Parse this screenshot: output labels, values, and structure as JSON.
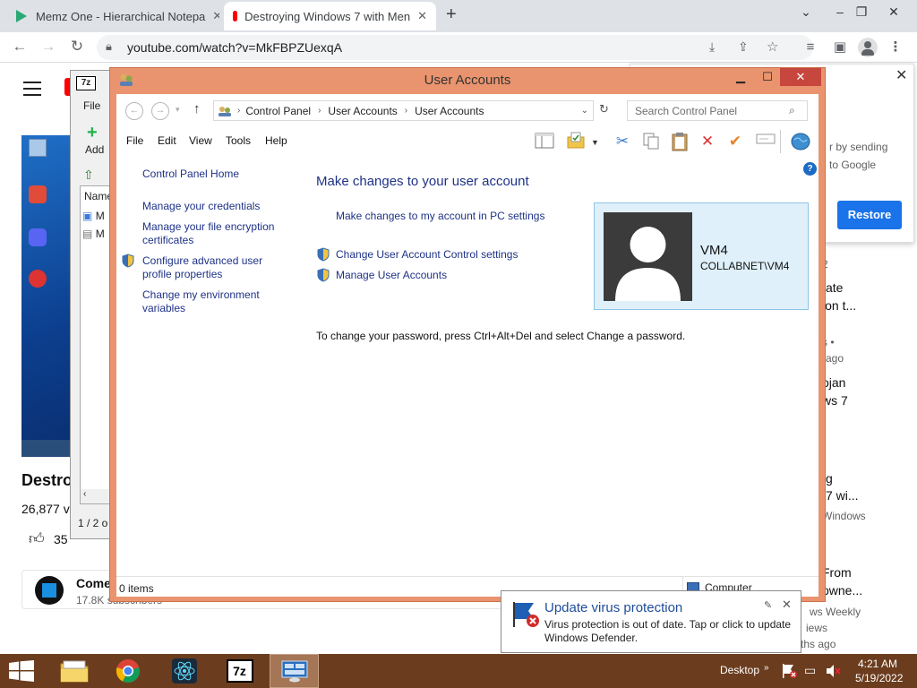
{
  "browser": {
    "tabs": [
      {
        "title": "Memz One - Hierarchical Notepa",
        "active": false
      },
      {
        "title": "Destroying Windows 7 with Men",
        "active": true
      }
    ],
    "new_tab": "+",
    "url": "youtube.com/watch?v=MkFBPZUexqA"
  },
  "youtube": {
    "video_title": "Destro",
    "views": "26,877 v",
    "likes": "35",
    "channel_name": "Come",
    "subscribers": "17.8K subscribers",
    "dialog": {
      "text_line1": "r by sending",
      "text_line2": "to Google",
      "restore_label": "Restore"
    },
    "sidebar_fragments": [
      "2",
      "ate",
      "ion t...",
      "s •",
      "ago",
      "ojan",
      "ws 7",
      "g",
      "7 wi...",
      "Windows",
      "From",
      "owne...",
      "ws Weekly",
      "iews",
      "ths ago"
    ]
  },
  "sevenzip": {
    "menu_file": "File",
    "add_label": "Add",
    "col_name": "Name",
    "status": "1 / 2 o",
    "rows": [
      "M",
      "M"
    ]
  },
  "window": {
    "title": "User Accounts",
    "breadcrumb": [
      "Control Panel",
      "User Accounts",
      "User Accounts"
    ],
    "search_placeholder": "Search Control Panel",
    "menu": [
      "File",
      "Edit",
      "View",
      "Tools",
      "Help"
    ],
    "left_links": [
      "Control Panel Home",
      "Manage your credentials",
      "Manage your file encryption certificates",
      "Configure advanced user profile properties",
      "Change my environment variables"
    ],
    "heading": "Make changes to your user account",
    "pc_settings_link": "Make changes to my account in PC settings",
    "uac_link": "Change User Account Control settings",
    "manage_link": "Manage User Accounts",
    "password_note": "To change your password, press Ctrl+Alt+Del and select Change a password.",
    "user": {
      "name": "VM4",
      "domain": "COLLABNET\\VM4"
    },
    "status_items": "0 items",
    "status_location": "Computer"
  },
  "notification": {
    "title": "Update virus protection",
    "body": "Virus protection is out of date. Tap or click to update Windows Defender."
  },
  "taskbar": {
    "desktop_label": "Desktop",
    "time": "4:21 AM",
    "date": "5/19/2022"
  },
  "colors": {
    "window_frame": "#e9946e",
    "link": "#1e3287",
    "taskbar": "#6b3d1e",
    "restore_button": "#1a73e8"
  }
}
